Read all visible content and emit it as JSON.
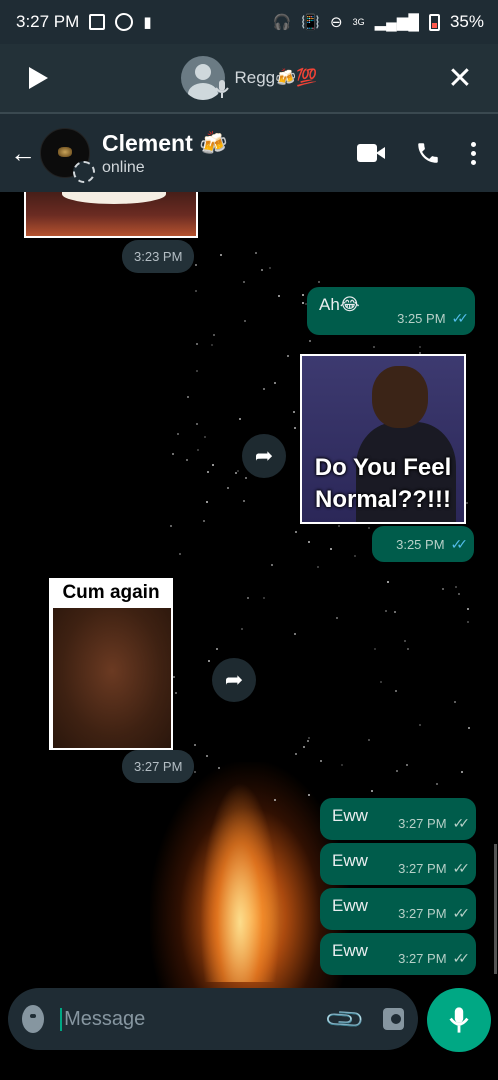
{
  "status_bar": {
    "time": "3:27 PM",
    "network": "3G",
    "battery": "35%"
  },
  "voice_chat": {
    "name": "Regg🍻💯"
  },
  "chat_header": {
    "name": "Clement 🍻",
    "status": "online"
  },
  "messages": [
    {
      "type": "image-in",
      "time": "3:23 PM"
    },
    {
      "type": "text-out",
      "text": "Ah😂",
      "time": "3:25 PM",
      "ticks": "read"
    },
    {
      "type": "image-out",
      "caption": "Do You Feel Normal??!!!",
      "time": "3:25 PM",
      "ticks": "read"
    },
    {
      "type": "image-in",
      "caption": "Cum again",
      "time": "3:27 PM"
    },
    {
      "type": "text-out",
      "text": "Eww",
      "time": "3:27 PM",
      "ticks": "sent"
    },
    {
      "type": "text-out",
      "text": "Eww",
      "time": "3:27 PM",
      "ticks": "sent"
    },
    {
      "type": "text-out",
      "text": "Eww",
      "time": "3:27 PM",
      "ticks": "sent"
    },
    {
      "type": "text-out",
      "text": "Eww",
      "time": "3:27 PM",
      "ticks": "sent"
    }
  ],
  "meme_caption_line1": "Do You Feel",
  "meme_caption_line2": "Normal??!!!",
  "input": {
    "placeholder": "Message"
  },
  "colors": {
    "outgoing_bubble": "#005c4b",
    "header_bg": "#1f2c34",
    "accent": "#00a884",
    "read_tick": "#53bdeb"
  }
}
